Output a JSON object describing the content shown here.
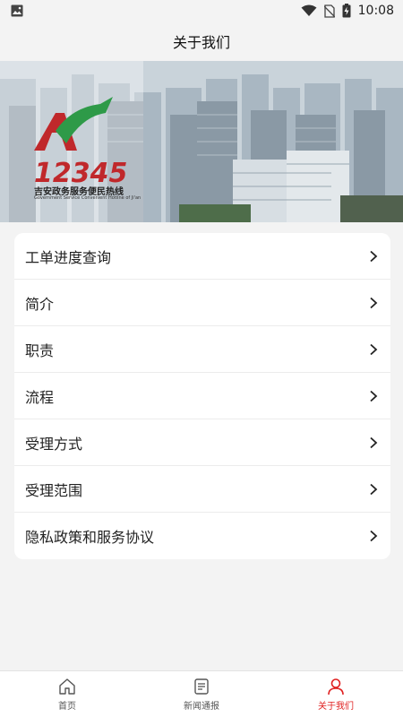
{
  "status_bar": {
    "time": "10:08",
    "icons": [
      "image-icon",
      "wifi-icon",
      "no-sim-icon",
      "battery-charging-icon"
    ]
  },
  "header": {
    "title": "关于我们"
  },
  "banner": {
    "logo_number": "12345",
    "logo_subtitle": "吉安政务服务便民热线",
    "logo_english": "Government Service Convenient Hotline of Ji'an",
    "brand_red": "#c0282b",
    "brand_green": "#2e9a48"
  },
  "menu": {
    "items": [
      {
        "label": "工单进度查询"
      },
      {
        "label": "简介"
      },
      {
        "label": "职责"
      },
      {
        "label": "流程"
      },
      {
        "label": "受理方式"
      },
      {
        "label": "受理范围"
      },
      {
        "label": "隐私政策和服务协议"
      }
    ]
  },
  "bottom_nav": {
    "accent": "#e02020",
    "tabs": [
      {
        "label": "首页",
        "icon": "home-icon",
        "active": false
      },
      {
        "label": "新闻通报",
        "icon": "news-icon",
        "active": false
      },
      {
        "label": "关于我们",
        "icon": "user-icon",
        "active": true
      }
    ]
  }
}
